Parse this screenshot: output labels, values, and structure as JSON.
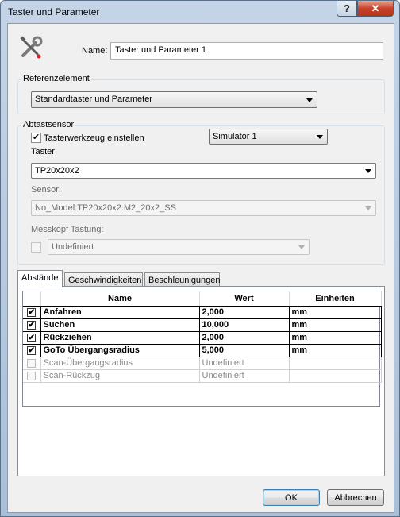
{
  "window": {
    "title": "Taster und Parameter",
    "help_glyph": "?",
    "close_glyph": "✕"
  },
  "name_field": {
    "label": "Name:",
    "value": "Taster und Parameter 1",
    "icon": "tools-icon"
  },
  "reference": {
    "group_label": "Referenzelement",
    "selected": "Standardtaster und Parameter"
  },
  "probe": {
    "group_label": "Abtastsensor",
    "set_tool_label": "Tasterwerkzeug einstellen",
    "set_tool_checked": true,
    "simulator_selected": "Simulator 1",
    "probe_label": "Taster:",
    "probe_selected": "TP20x20x2",
    "sensor_label": "Sensor:",
    "sensor_selected": "No_Model:TP20x20x2:M2_20x2_SS",
    "head_label": "Messkopf Tastung:",
    "head_checked": false,
    "head_selected": "Undefiniert"
  },
  "tabs": [
    {
      "label": "Abstände",
      "active": true
    },
    {
      "label": "Geschwindigkeiten",
      "active": false
    },
    {
      "label": "Beschleunigungen",
      "active": false
    }
  ],
  "table": {
    "columns": [
      "Name",
      "Wert",
      "Einheiten"
    ],
    "rows": [
      {
        "checked": true,
        "enabled": true,
        "name": "Anfahren",
        "value": "2,000",
        "unit": "mm"
      },
      {
        "checked": true,
        "enabled": true,
        "name": "Suchen",
        "value": "10,000",
        "unit": "mm"
      },
      {
        "checked": true,
        "enabled": true,
        "name": "Rückziehen",
        "value": "2,000",
        "unit": "mm"
      },
      {
        "checked": true,
        "enabled": true,
        "name": "GoTo Übergangsradius",
        "value": "5,000",
        "unit": "mm"
      },
      {
        "checked": false,
        "enabled": false,
        "name": "Scan-Übergangsradius",
        "value": "Undefiniert",
        "unit": ""
      },
      {
        "checked": false,
        "enabled": false,
        "name": "Scan-Rückzug",
        "value": "Undefiniert",
        "unit": ""
      }
    ]
  },
  "buttons": {
    "ok": "OK",
    "cancel": "Abbrechen"
  },
  "check_glyph": "✔"
}
